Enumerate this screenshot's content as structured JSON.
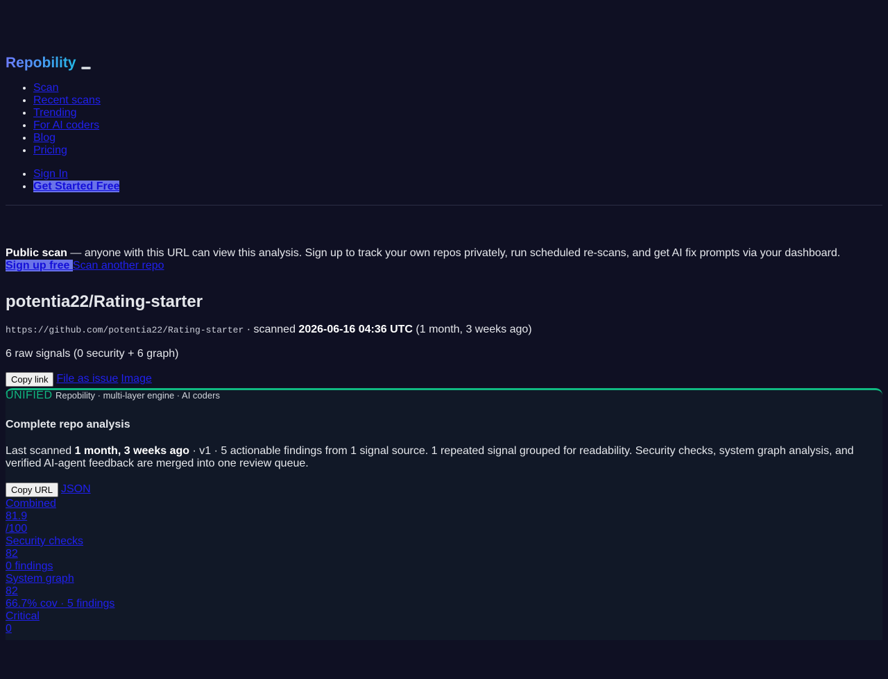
{
  "header": {
    "brand": "Repobility",
    "nav_items": [
      "Scan",
      "Recent scans",
      "Trending",
      "For AI coders",
      "Blog",
      "Pricing"
    ],
    "auth_items": [
      "Sign In",
      "Get Started Free"
    ]
  },
  "notice": {
    "bold": "Public scan",
    "text": " — anyone with this URL can view this analysis. Sign up to track your own repos privately, run scheduled re-scans, and get AI fix prompts via your dashboard.",
    "signup_label": "Sign up free ",
    "scan_another_label": "Scan another repo"
  },
  "repo": {
    "title": "potentia22/Rating-starter",
    "url": "https://github.com/potentia22/Rating-starter",
    "scanned_prefix": " · scanned ",
    "scanned_at": "2026-06-16 04:36 UTC",
    "scanned_ago": " (1 month, 3 weeks ago)",
    "signals": "6 raw signals (0 security + 6 graph)",
    "copy_link_label": "Copy link",
    "file_issue_label": "File as issue",
    "image_label": "Image"
  },
  "card": {
    "badge": "UNIFIED",
    "subtitle": "Repobility · multi-layer engine · AI coders",
    "title": "Complete repo analysis",
    "desc_prefix": "Last scanned ",
    "desc_bold": "1 month, 3 weeks ago",
    "desc_rest": " · v1 · 5 actionable findings from 1 signal source. 1 repeated signal grouped for readability. Security checks, system graph analysis, and verified AI-agent feedback are merged into one review queue.",
    "copy_url_label": "Copy URL",
    "json_label": "JSON"
  },
  "stats": {
    "combined_label": "Combined",
    "combined_value": "81.9",
    "combined_max": "/100",
    "security_label": "Security checks",
    "security_value": "82",
    "security_detail": "0 findings",
    "graph_label": "System graph",
    "graph_value": "82",
    "graph_detail": "66.7% cov · 5 findings",
    "critical_label": "Critical",
    "critical_value": "0"
  }
}
